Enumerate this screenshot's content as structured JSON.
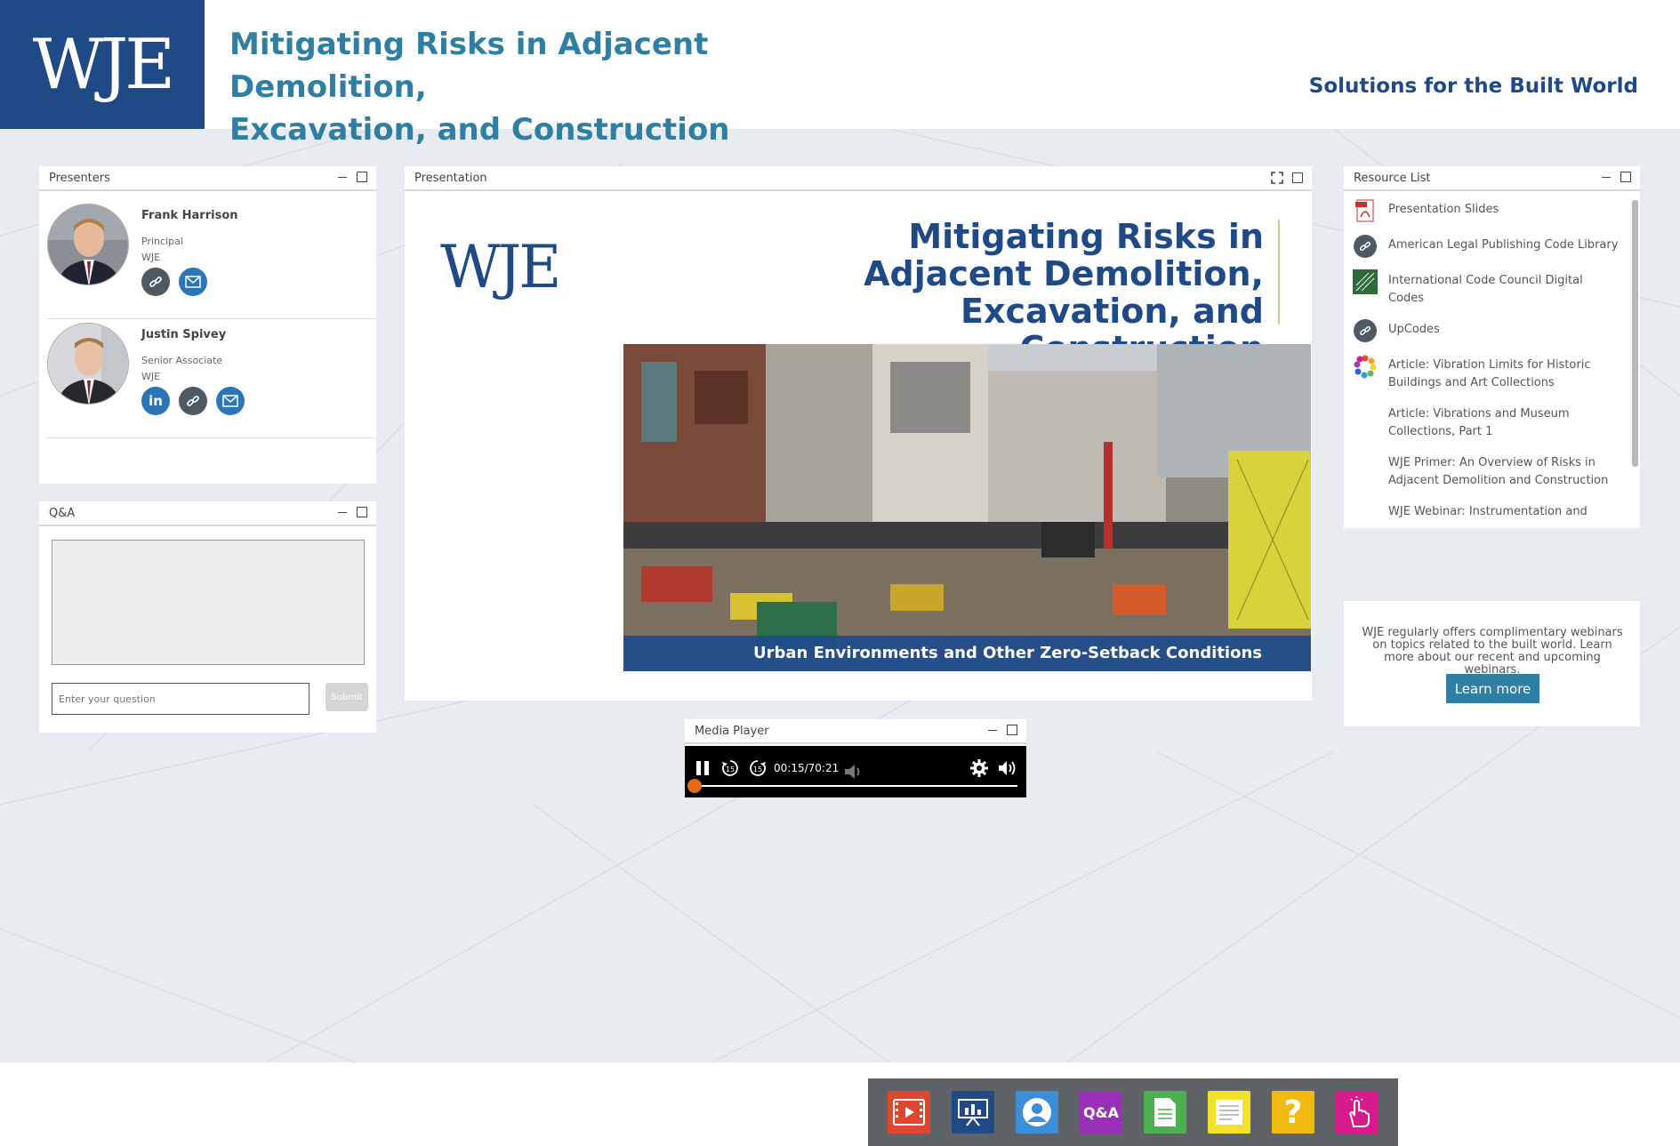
{
  "header": {
    "logo": "WJE",
    "title_line1": "Mitigating Risks in Adjacent Demolition,",
    "title_line2": "Excavation, and Construction",
    "tagline": "Solutions for the Built World"
  },
  "presenters_panel": {
    "title": "Presenters",
    "presenters": [
      {
        "name": "Frank Harrison",
        "title": "Principal",
        "org": "WJE",
        "links": [
          "link-icon",
          "email-icon"
        ]
      },
      {
        "name": "Justin Spivey",
        "title": "Senior Associate",
        "org": "WJE",
        "links": [
          "linkedin-icon",
          "link-icon",
          "email-icon"
        ]
      }
    ]
  },
  "qa_panel": {
    "title": "Q&A",
    "input_placeholder": "Enter your question",
    "submit_label": "Submit"
  },
  "presentation_panel": {
    "title": "Presentation",
    "slide": {
      "logo": "WJE",
      "title": "Mitigating Risks in Adjacent Demolition, Excavation, and Construction",
      "caption": "Urban Environments and Other Zero-Setback Conditions"
    }
  },
  "resource_panel": {
    "title": "Resource List",
    "items": [
      {
        "label": "Presentation Slides",
        "icon": "pdf-icon"
      },
      {
        "label": "American Legal Publishing Code Library",
        "icon": "link-icon"
      },
      {
        "label": "International Code Council Digital Codes",
        "icon": "icc-logo-icon"
      },
      {
        "label": "UpCodes",
        "icon": "link-icon"
      },
      {
        "label": "Article: Vibration Limits for Historic Buildings and Art Collections",
        "icon": "flower-icon"
      },
      {
        "label": "Article: Vibrations and Museum Collections, Part 1",
        "icon": ""
      },
      {
        "label": "WJE Primer: An Overview of Risks in Adjacent Demolition and Construction",
        "icon": ""
      },
      {
        "label": "WJE Webinar: Instrumentation and Monitoring of Adjacent Structures during Construction",
        "icon": ""
      }
    ]
  },
  "promo": {
    "text": "WJE regularly offers complimentary webinars on topics related to the built world. Learn more about our recent and upcoming webinars.",
    "button_label": "Learn more"
  },
  "media_player": {
    "title": "Media Player",
    "time": "00:15/70:21",
    "progress": 0.004
  },
  "dock": {
    "items": [
      {
        "name": "media-player",
        "color": "#e0462d"
      },
      {
        "name": "presentation",
        "color": "#1f4a86"
      },
      {
        "name": "presenters",
        "color": "#3b8fd9"
      },
      {
        "name": "qa",
        "color": "#9b30b8",
        "label": "Q&A"
      },
      {
        "name": "resources",
        "color": "#4caf50"
      },
      {
        "name": "notes",
        "color": "#f2e32a"
      },
      {
        "name": "help",
        "color": "#f2b90f"
      },
      {
        "name": "engagement",
        "color": "#d81b8c"
      }
    ]
  },
  "colors": {
    "brand_blue": "#1f4a86",
    "accent_teal": "#2f7fa4",
    "progress_orange": "#e36a14"
  }
}
